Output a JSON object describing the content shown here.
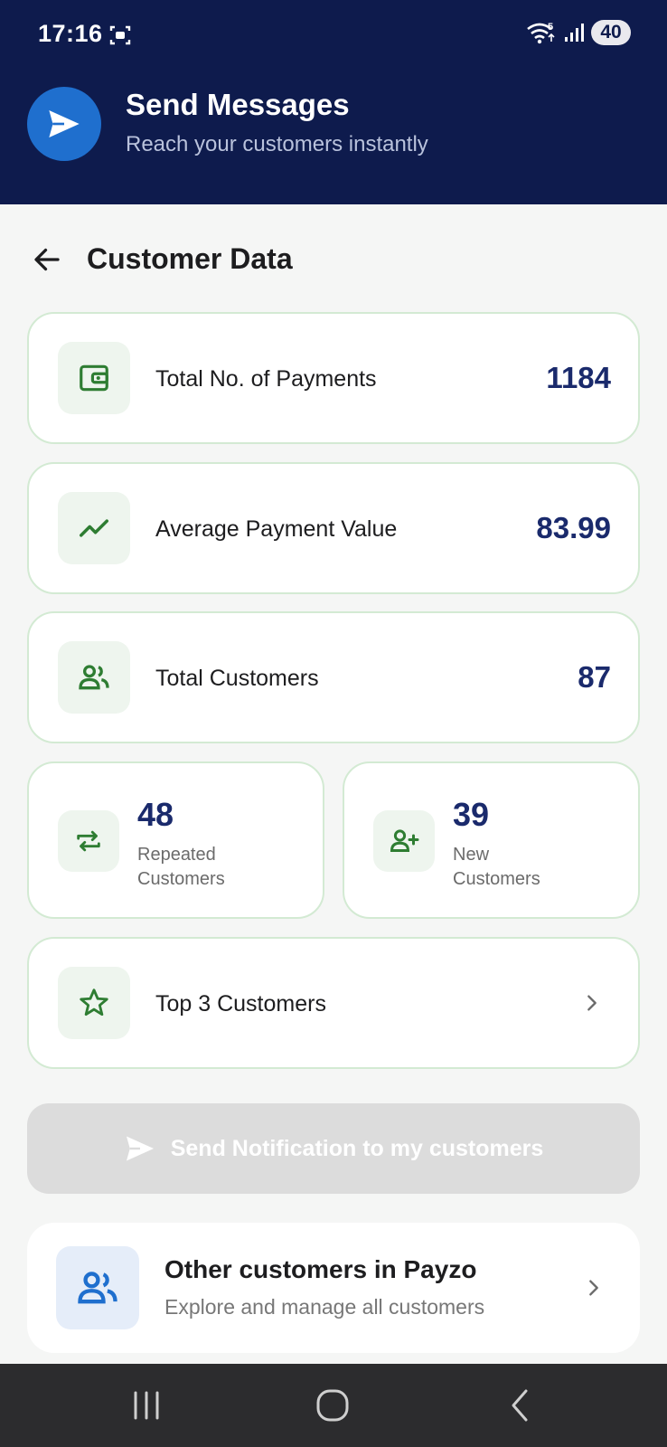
{
  "status_bar": {
    "time": "17:16",
    "battery": "40",
    "wifi_badge": "5"
  },
  "header": {
    "title": "Send Messages",
    "subtitle": "Reach your customers instantly"
  },
  "page": {
    "title": "Customer Data"
  },
  "cards": {
    "payments": {
      "label": "Total No. of Payments",
      "value": "1184"
    },
    "average": {
      "label": "Average Payment Value",
      "value": "83.99"
    },
    "customers": {
      "label": "Total Customers",
      "value": "87"
    },
    "repeated": {
      "value": "48",
      "label_line1": "Repeated",
      "label_line2": "Customers"
    },
    "new": {
      "value": "39",
      "label_line1": "New",
      "label_line2": "Customers"
    },
    "top": {
      "label": "Top 3 Customers"
    }
  },
  "send_button": {
    "label": "Send Notification to my customers"
  },
  "other": {
    "title": "Other customers in Payzo",
    "subtitle": "Explore and manage all customers"
  },
  "icons": {
    "header": "send-icon",
    "payments": "wallet-icon",
    "average": "trending-up-icon",
    "customers": "group-icon",
    "repeated": "repeat-icon",
    "new": "person-add-icon",
    "top": "star-icon",
    "other": "group-icon"
  },
  "colors": {
    "header_bg": "#0e1b4d",
    "accent_blue": "#1f6fce",
    "value_navy": "#1a2a6c",
    "icon_green": "#2e7d32",
    "card_border": "#d3ead3",
    "disabled_button": "#dcdcdc"
  }
}
